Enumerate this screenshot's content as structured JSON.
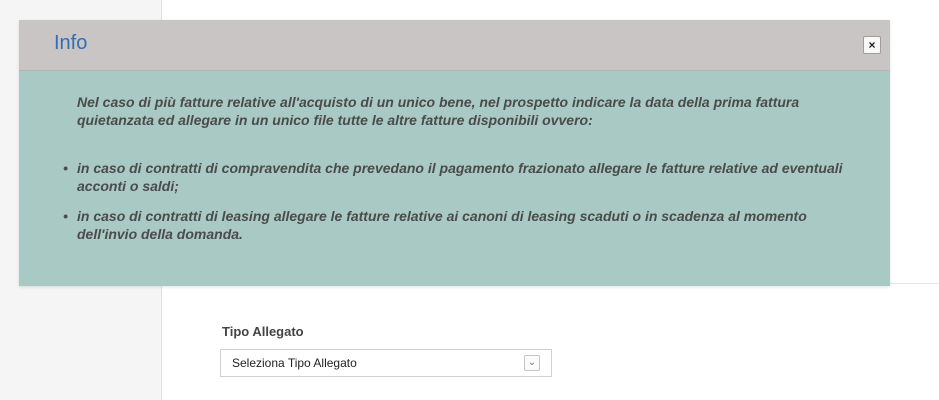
{
  "background": {
    "field_label": "Tipo Allegato",
    "select": {
      "selected": "Seleziona Tipo Allegato"
    }
  },
  "modal": {
    "title": "Info",
    "intro": "Nel caso di più fatture relative all'acquisto di un unico bene, nel prospetto indicare la data della prima fattura quietanzata ed allegare in un unico file tutte le altre fatture disponibili ovvero:",
    "bullets": [
      "in caso di contratti di compravendita che prevedano il pagamento frazionato allegare le fatture relative ad eventuali acconti o saldi;",
      "in caso di contratti di leasing allegare le fatture relative ai canoni di leasing scaduti o in scadenza al momento dell'invio della domanda."
    ]
  }
}
